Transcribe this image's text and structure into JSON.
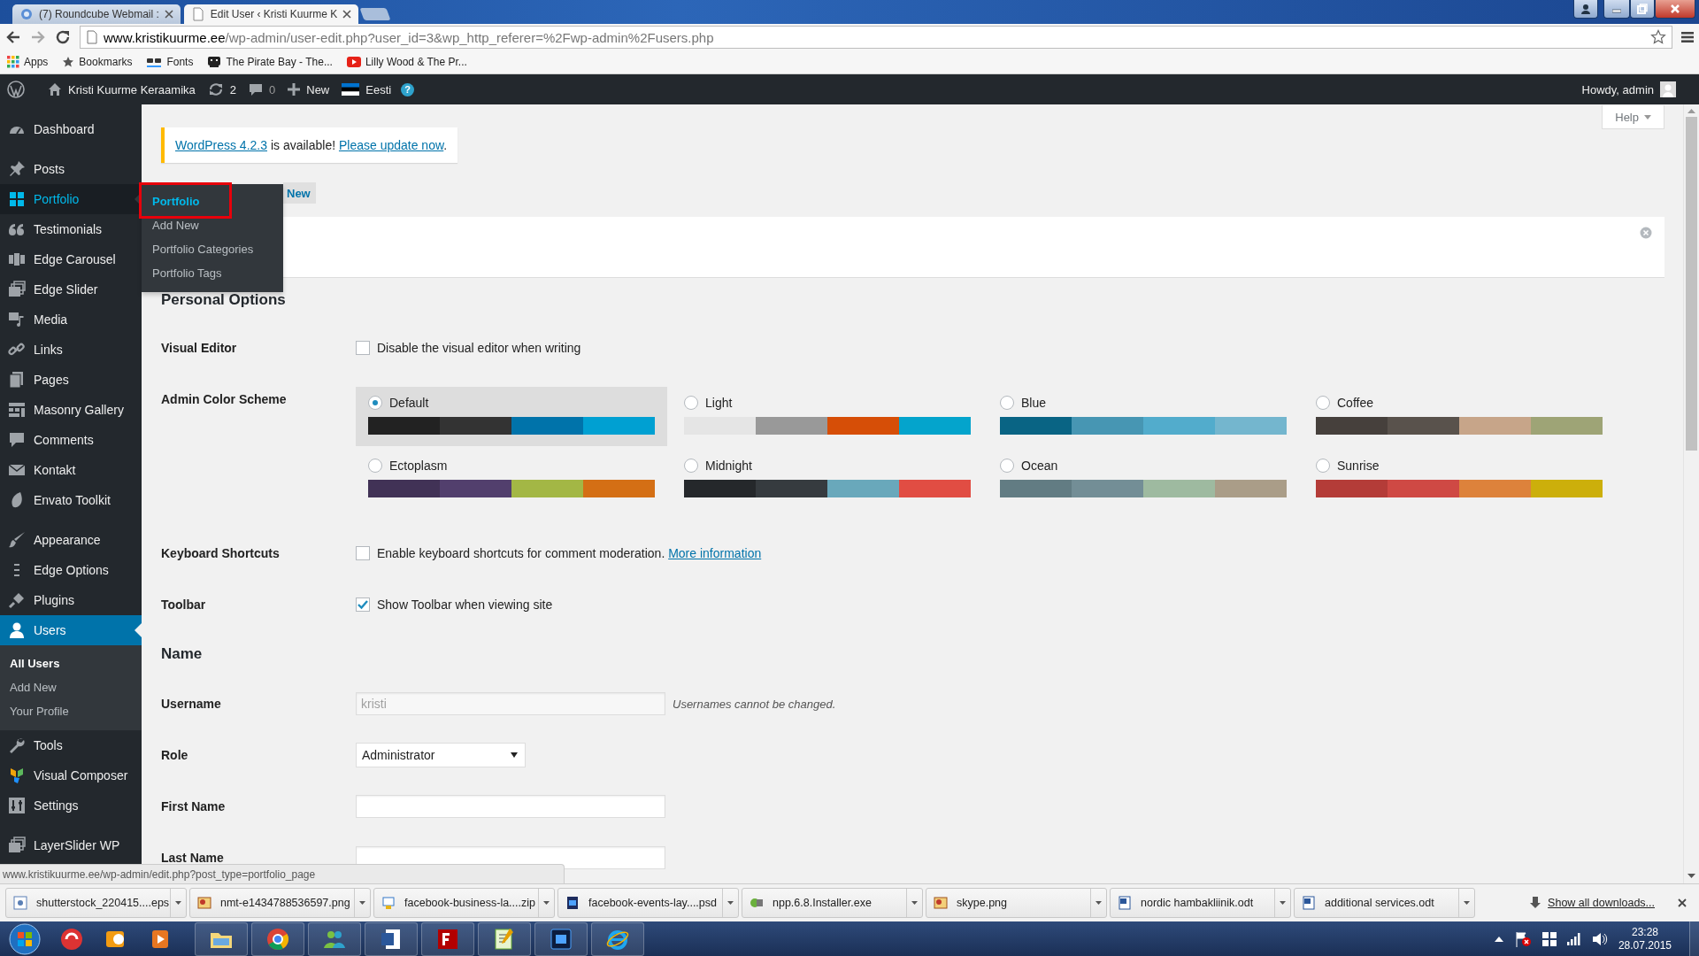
{
  "browser": {
    "tabs": [
      {
        "title": "(7) Roundcube Webmail :",
        "selected": false
      },
      {
        "title": "Edit User ‹ Kristi Kuurme K",
        "selected": true
      }
    ],
    "address": {
      "domain": "www.kristikuurme.ee",
      "path": "/wp-admin/user-edit.php?user_id=3&wp_http_referer=%2Fwp-admin%2Fusers.php"
    },
    "bookmarks": [
      {
        "label": "Apps"
      },
      {
        "label": "Bookmarks"
      },
      {
        "label": "Fonts"
      },
      {
        "label": "The Pirate Bay - The..."
      },
      {
        "label": "Lilly Wood & The Pr..."
      }
    ]
  },
  "admin_bar": {
    "site_name": "Kristi Kuurme Keraamika",
    "updates": "2",
    "comments": "0",
    "new": "New",
    "language": "Eesti",
    "help_glyph": "?",
    "greeting": "Howdy, admin"
  },
  "sidebar": {
    "groups": [
      {
        "items": [
          {
            "label": "Dashboard",
            "selected": false,
            "hovered": false
          }
        ]
      },
      {
        "items": [
          {
            "label": "Posts",
            "selected": false,
            "hovered": false
          },
          {
            "label": "Portfolio",
            "selected": false,
            "hovered": true,
            "flyout": [
              {
                "label": "Portfolio",
                "selected": true,
                "annotated": true
              },
              {
                "label": "Add New",
                "selected": false,
                "annotated": false
              },
              {
                "label": "Portfolio Categories",
                "selected": false,
                "annotated": false
              },
              {
                "label": "Portfolio Tags",
                "selected": false,
                "annotated": false
              }
            ]
          },
          {
            "label": "Testimonials",
            "selected": false,
            "hovered": false
          },
          {
            "label": "Edge Carousel",
            "selected": false,
            "hovered": false
          },
          {
            "label": "Edge Slider",
            "selected": false,
            "hovered": false
          },
          {
            "label": "Media",
            "selected": false,
            "hovered": false
          },
          {
            "label": "Links",
            "selected": false,
            "hovered": false
          },
          {
            "label": "Pages",
            "selected": false,
            "hovered": false
          },
          {
            "label": "Masonry Gallery",
            "selected": false,
            "hovered": false
          },
          {
            "label": "Comments",
            "selected": false,
            "hovered": false
          },
          {
            "label": "Kontakt",
            "selected": false,
            "hovered": false
          },
          {
            "label": "Envato Toolkit",
            "selected": false,
            "hovered": false
          }
        ]
      },
      {
        "items": [
          {
            "label": "Appearance",
            "selected": false,
            "hovered": false
          },
          {
            "label": "Edge Options",
            "selected": false,
            "hovered": false
          },
          {
            "label": "Plugins",
            "selected": false,
            "hovered": false
          },
          {
            "label": "Users",
            "selected": true,
            "hovered": false,
            "submenu": [
              {
                "label": "All Users",
                "selected": true
              },
              {
                "label": "Add New",
                "selected": false
              },
              {
                "label": "Your Profile",
                "selected": false
              }
            ]
          },
          {
            "label": "Tools",
            "selected": false,
            "hovered": false
          },
          {
            "label": "Visual Composer",
            "selected": false,
            "hovered": false
          },
          {
            "label": "Settings",
            "selected": false,
            "hovered": false
          }
        ]
      },
      {
        "items": [
          {
            "label": "LayerSlider WP",
            "selected": false,
            "hovered": false
          }
        ]
      }
    ]
  },
  "content": {
    "help": "Help",
    "notice": {
      "version_link": "WordPress 4.2.3",
      "text": " is available! ",
      "update_link": "Please update now",
      "end": "."
    },
    "add_new": "New",
    "sections": [
      {
        "heading": "Personal Options",
        "rows": [
          {
            "kind": "checkbox",
            "label": "Visual Editor",
            "text": "Disable the visual editor when writing",
            "checked": false
          },
          {
            "kind": "color_scheme",
            "label": "Admin Color Scheme",
            "schemes": [
              {
                "name": "Default",
                "selected": true,
                "swatches": [
                  {
                    "color": "#222222"
                  },
                  {
                    "color": "#333333"
                  },
                  {
                    "color": "#0073aa"
                  },
                  {
                    "color": "#00a0d2"
                  }
                ]
              },
              {
                "name": "Light",
                "selected": false,
                "swatches": [
                  {
                    "color": "#e5e5e5"
                  },
                  {
                    "color": "#999999"
                  },
                  {
                    "color": "#d64e07"
                  },
                  {
                    "color": "#04a4cc"
                  }
                ]
              },
              {
                "name": "Blue",
                "selected": false,
                "swatches": [
                  {
                    "color": "#096484"
                  },
                  {
                    "color": "#4796b3"
                  },
                  {
                    "color": "#52accc"
                  },
                  {
                    "color": "#74b6ce"
                  }
                ]
              },
              {
                "name": "Coffee",
                "selected": false,
                "swatches": [
                  {
                    "color": "#46403c"
                  },
                  {
                    "color": "#59524c"
                  },
                  {
                    "color": "#c7a589"
                  },
                  {
                    "color": "#9ea476"
                  }
                ]
              },
              {
                "name": "Ectoplasm",
                "selected": false,
                "swatches": [
                  {
                    "color": "#413256"
                  },
                  {
                    "color": "#523f6d"
                  },
                  {
                    "color": "#a3b745"
                  },
                  {
                    "color": "#d46f15"
                  }
                ]
              },
              {
                "name": "Midnight",
                "selected": false,
                "swatches": [
                  {
                    "color": "#25282b"
                  },
                  {
                    "color": "#363b3f"
                  },
                  {
                    "color": "#69a8bb"
                  },
                  {
                    "color": "#e14d43"
                  }
                ]
              },
              {
                "name": "Ocean",
                "selected": false,
                "swatches": [
                  {
                    "color": "#627c83"
                  },
                  {
                    "color": "#738e96"
                  },
                  {
                    "color": "#9ebaa0"
                  },
                  {
                    "color": "#aa9d88"
                  }
                ]
              },
              {
                "name": "Sunrise",
                "selected": false,
                "swatches": [
                  {
                    "color": "#b43c38"
                  },
                  {
                    "color": "#cf4944"
                  },
                  {
                    "color": "#dd823b"
                  },
                  {
                    "color": "#ccaf0b"
                  }
                ]
              }
            ]
          },
          {
            "kind": "checkbox",
            "label": "Keyboard Shortcuts",
            "text": "Enable keyboard shortcuts for comment moderation.",
            "link": "More information",
            "checked": false
          },
          {
            "kind": "checkbox",
            "label": "Toolbar",
            "text": "Show Toolbar when viewing site",
            "checked": true
          }
        ]
      },
      {
        "heading": "Name",
        "rows": [
          {
            "kind": "text",
            "label": "Username",
            "value": "kristi",
            "disabled": true,
            "note": "Usernames cannot be changed."
          },
          {
            "kind": "select",
            "label": "Role",
            "value": "Administrator"
          },
          {
            "kind": "text",
            "label": "First Name"
          },
          {
            "kind": "text",
            "label": "Last Name"
          }
        ]
      }
    ]
  },
  "status_url": "www.kristikuurme.ee/wp-admin/edit.php?post_type=portfolio_page",
  "downloads": {
    "items": [
      {
        "name": "shutterstock_220415....eps"
      },
      {
        "name": "nmt-e1434788536597.png"
      },
      {
        "name": "facebook-business-la....zip"
      },
      {
        "name": "facebook-events-lay....psd"
      },
      {
        "name": "npp.6.8.Installer.exe"
      },
      {
        "name": "skype.png"
      },
      {
        "name": "nordic hambakliinik.odt"
      },
      {
        "name": "additional services.odt"
      }
    ],
    "show_all": "Show all downloads..."
  },
  "taskbar": {
    "time": "23:28",
    "date": "28.07.2015"
  }
}
